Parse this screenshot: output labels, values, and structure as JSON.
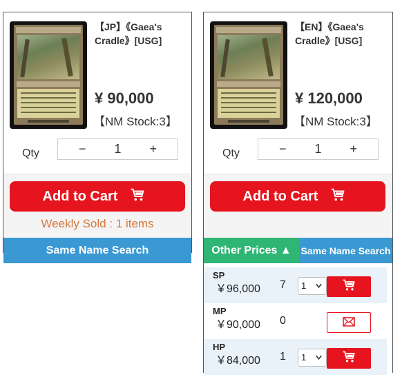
{
  "cards": [
    {
      "name": "【JP】《Gaea's Cradle》[USG]",
      "price": "¥ 90,000",
      "stock": "【NM Stock:3】",
      "qty_label": "Qty",
      "qty_value": "1",
      "qty_minus": "−",
      "qty_plus": "+",
      "add_to_cart": "Add to Cart",
      "weekly_sold": "Weekly Sold : 1 items",
      "same_name_search": "Same Name Search"
    },
    {
      "name": "【EN】《Gaea's Cradle》[USG]",
      "price": "¥ 120,000",
      "stock": "【NM Stock:3】",
      "qty_label": "Qty",
      "qty_value": "1",
      "qty_minus": "−",
      "qty_plus": "+",
      "add_to_cart": "Add to Cart",
      "other_prices_tab": "Other Prices ▲",
      "same_name_search": "Same Name Search",
      "other_prices": [
        {
          "condition": "SP",
          "price": "￥96,000",
          "stock": "7",
          "select": "1",
          "action": "cart"
        },
        {
          "condition": "MP",
          "price": "￥90,000",
          "stock": "0",
          "select": "",
          "action": "mail"
        },
        {
          "condition": "HP",
          "price": "￥84,000",
          "stock": "1",
          "select": "1",
          "action": "cart"
        }
      ]
    }
  ],
  "colors": {
    "cart_red": "#e6141e",
    "search_blue": "#3a98d3",
    "other_prices_green": "#2fb574",
    "weekly_orange": "#d4783a"
  },
  "icons": {
    "cart": "shopping-cart-icon",
    "mail": "envelope-icon",
    "select": "chevron-down-icon"
  }
}
